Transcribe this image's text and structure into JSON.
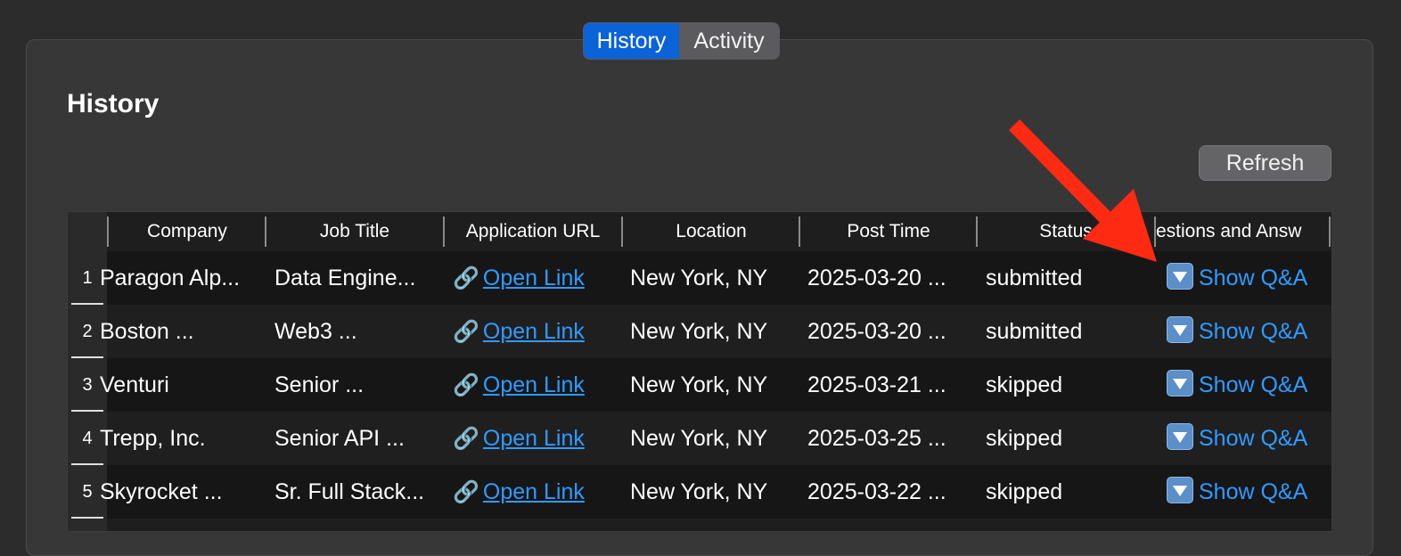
{
  "tabs": [
    {
      "label": "History",
      "active": true
    },
    {
      "label": "Activity",
      "active": false
    }
  ],
  "section_title": "History",
  "refresh_label": "Refresh",
  "table": {
    "columns": [
      "Company",
      "Job Title",
      "Application URL",
      "Location",
      "Post Time",
      "Status",
      "estions and Answ"
    ],
    "rows": [
      {
        "index": "1",
        "company": "Paragon Alp...",
        "job_title": "Data Engine...",
        "url_label": "Open Link",
        "location": "New York, NY",
        "post_time": "2025-03-20 ...",
        "status": "submitted",
        "qa_label": "Show Q&A"
      },
      {
        "index": "2",
        "company": "Boston ...",
        "job_title": "Web3 ...",
        "url_label": "Open Link",
        "location": "New York, NY",
        "post_time": "2025-03-20 ...",
        "status": "submitted",
        "qa_label": "Show Q&A"
      },
      {
        "index": "3",
        "company": "Venturi",
        "job_title": "Senior ...",
        "url_label": "Open Link",
        "location": "New York, NY",
        "post_time": "2025-03-21 ...",
        "status": "skipped",
        "qa_label": "Show Q&A"
      },
      {
        "index": "4",
        "company": "Trepp, Inc.",
        "job_title": "Senior API ...",
        "url_label": "Open Link",
        "location": "New York, NY",
        "post_time": "2025-03-25 ...",
        "status": "skipped",
        "qa_label": "Show Q&A"
      },
      {
        "index": "5",
        "company": "Skyrocket ...",
        "job_title": "Sr. Full Stack...",
        "url_label": "Open Link",
        "location": "New York, NY",
        "post_time": "2025-03-22 ...",
        "status": "skipped",
        "qa_label": "Show Q&A"
      }
    ]
  },
  "icons": {
    "link_icon": "link-icon",
    "qa_icon": "down-arrow-box-icon"
  },
  "colors": {
    "accent": "#0a63d8",
    "link": "#2f9bff",
    "annotation_arrow": "#ff2a12"
  }
}
